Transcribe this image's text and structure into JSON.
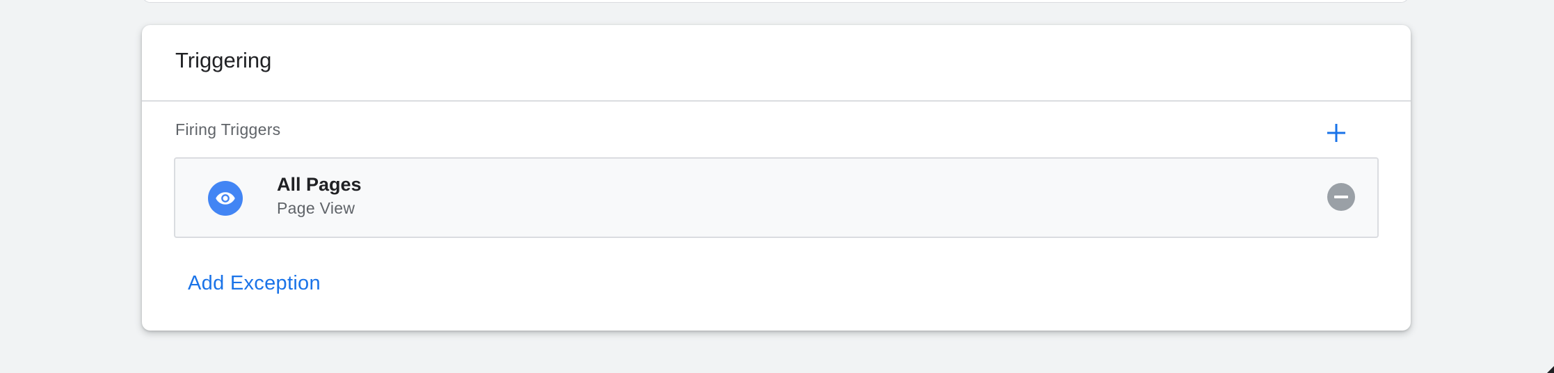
{
  "triggering": {
    "title": "Triggering",
    "firing_triggers_label": "Firing Triggers",
    "add_icon": "plus-icon",
    "triggers": [
      {
        "name": "All Pages",
        "type": "Page View",
        "icon": "eye-icon",
        "icon_color": "#4285f4",
        "remove_icon": "minus-circle-icon"
      }
    ],
    "add_exception_label": "Add Exception"
  },
  "colors": {
    "accent": "#1a73e8",
    "page_background": "#f1f3f4",
    "remove_button": "#9aa0a6"
  }
}
